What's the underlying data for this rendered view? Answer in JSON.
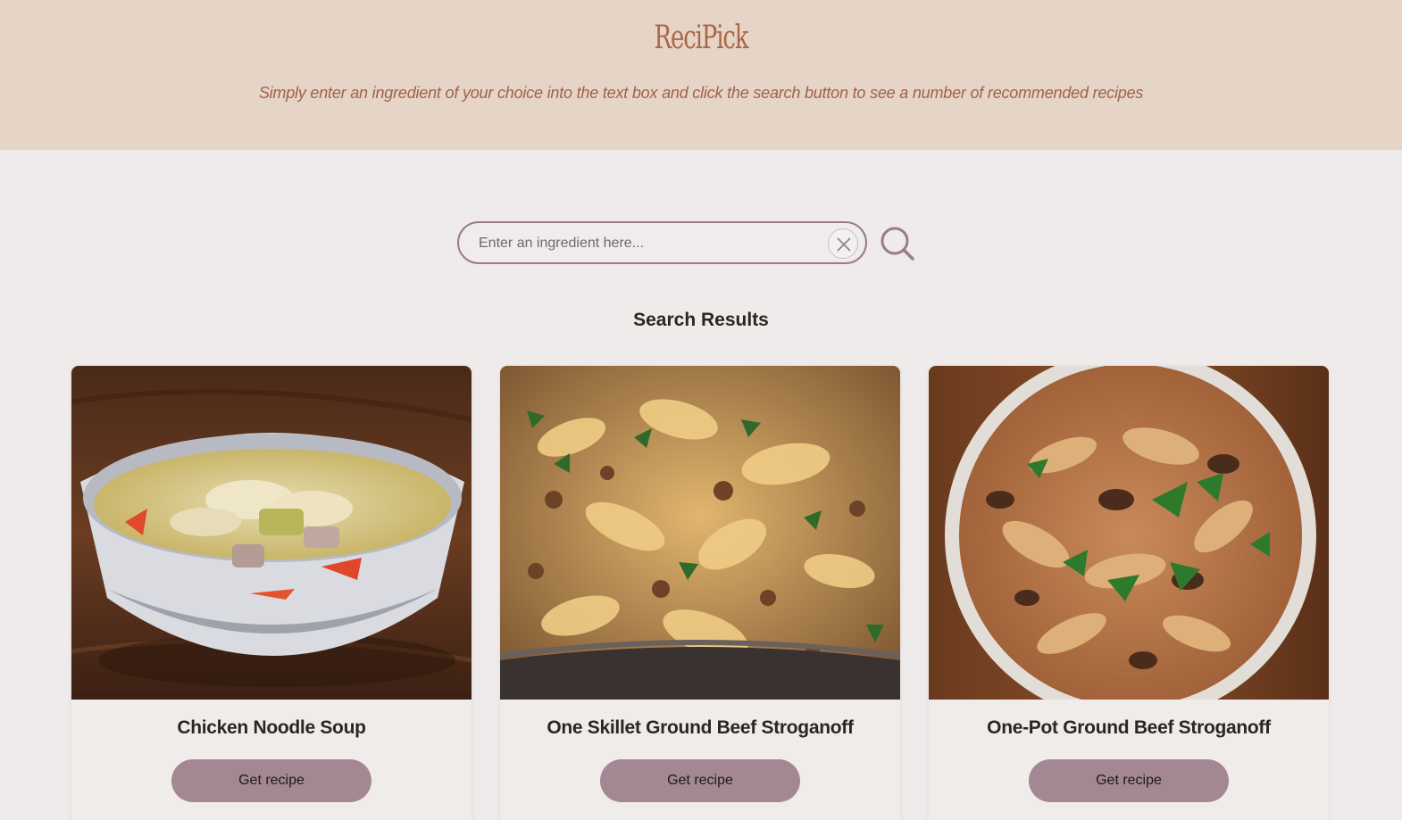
{
  "header": {
    "logo": "ReciPick",
    "subtitle": "Simply enter an ingredient of your choice into the text box and click the search button to see a number of recommended recipes"
  },
  "search": {
    "placeholder": "Enter an ingredient here...",
    "value": ""
  },
  "results": {
    "title": "Search Results",
    "cards": [
      {
        "name": "Chicken Noodle Soup",
        "button": "Get recipe"
      },
      {
        "name": "One Skillet Ground Beef Stroganoff",
        "button": "Get recipe"
      },
      {
        "name": "One-Pot Ground Beef Stroganoff",
        "button": "Get recipe"
      }
    ]
  },
  "colors": {
    "header_bg": "#e6d4c6",
    "logo": "#a86848",
    "accent": "#a38792",
    "page_bg": "#eeebea"
  },
  "icons": {
    "clear": "close-icon",
    "search": "search-icon"
  }
}
